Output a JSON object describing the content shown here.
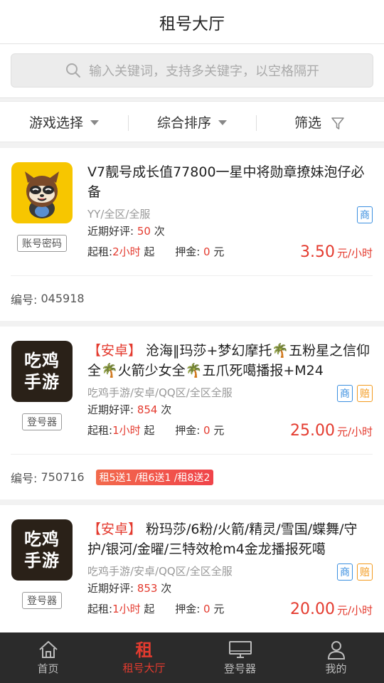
{
  "header": {
    "title": "租号大厅"
  },
  "search": {
    "placeholder": "输入关键词，支持多关键字，以空格隔开"
  },
  "filters": [
    {
      "label": "游戏选择"
    },
    {
      "label": "综合排序"
    },
    {
      "label": "筛选"
    }
  ],
  "listings": [
    {
      "title": "V7靓号成长值77800一星中将勋章撩妹泡仔必备",
      "platform": "",
      "login_type": "账号密码",
      "meta": "YY/全区/全服",
      "good_label": "近期好评:",
      "good_count": "50",
      "good_unit": "次",
      "rent_label": "起租:",
      "rent_hours": "2小时",
      "rent_suffix": "起",
      "deposit_label": "押金:",
      "deposit_value": "0",
      "deposit_unit": "元",
      "price": "3.50",
      "price_unit": "元/小时",
      "badges": [
        "商"
      ],
      "id_label": "编号:",
      "id": "045918",
      "promo": ""
    },
    {
      "title": "沧海‖玛莎+梦幻摩托🌴五粉星之信仰全🌴火箭少女全🌴五爪死噶播报+M24",
      "platform": "【安卓】",
      "login_type": "登号器",
      "avatar_line1": "吃鸡",
      "avatar_line2": "手游",
      "meta": "吃鸡手游/安卓/QQ区/全区全服",
      "good_label": "近期好评:",
      "good_count": "854",
      "good_unit": "次",
      "rent_label": "起租:",
      "rent_hours": "1小时",
      "rent_suffix": "起",
      "deposit_label": "押金:",
      "deposit_value": "0",
      "deposit_unit": "元",
      "price": "25.00",
      "price_unit": "元/小时",
      "badges": [
        "商",
        "赔"
      ],
      "id_label": "编号:",
      "id": "750716",
      "promo": "租5送1 /租6送1 /租8送2"
    },
    {
      "title": "粉玛莎/6粉/火箭/精灵/雪国/蝶舞/守护/银河/金曜/三特效枪m4金龙播报死噶",
      "platform": "【安卓】",
      "login_type": "登号器",
      "avatar_line1": "吃鸡",
      "avatar_line2": "手游",
      "meta": "吃鸡手游/安卓/QQ区/全区全服",
      "good_label": "近期好评:",
      "good_count": "853",
      "good_unit": "次",
      "rent_label": "起租:",
      "rent_hours": "1小时",
      "rent_suffix": "起",
      "deposit_label": "押金:",
      "deposit_value": "0",
      "deposit_unit": "元",
      "price": "20.00",
      "price_unit": "元/小时",
      "badges": [
        "商",
        "赔"
      ]
    }
  ],
  "tabbar": [
    {
      "label": "首页",
      "icon": "home-icon"
    },
    {
      "label": "租号大厅",
      "icon": "zu-icon",
      "glyph": "租",
      "active": true
    },
    {
      "label": "登号器",
      "icon": "monitor-icon"
    },
    {
      "label": "我的",
      "icon": "user-icon"
    }
  ],
  "colors": {
    "accent": "#e43b2f",
    "shang": "#3b8fe0",
    "pei": "#f39a1e",
    "tabbar_bg": "#2b2b2b"
  }
}
